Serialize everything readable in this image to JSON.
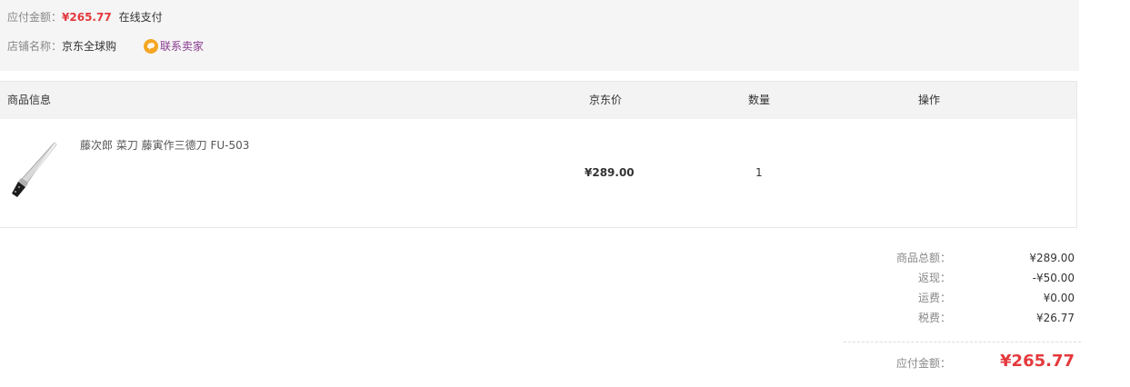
{
  "order_info": {
    "amount_label": "应付金额：",
    "amount_value": "¥265.77",
    "pay_method": "在线支付",
    "shop_label": "店铺名称：",
    "shop_name": "京东全球购",
    "contact_label": "联系卖家"
  },
  "table": {
    "headers": {
      "info": "商品信息",
      "price": "京东价",
      "qty": "数量",
      "op": "操作"
    },
    "item": {
      "name": "藤次郎 菜刀 藤寅作三德刀 FU-503",
      "price": "¥289.00",
      "qty": "1",
      "image_icon": "kitchen-knife-image"
    }
  },
  "summary": {
    "goods_total_label": "商品总额：",
    "goods_total_value": "¥289.00",
    "rebate_label": "返现：",
    "rebate_value": "-¥50.00",
    "shipping_label": "运费：",
    "shipping_value": "¥0.00",
    "tax_label": "税费：",
    "tax_value": "¥26.77",
    "payable_label": "应付金额：",
    "payable_value": "¥265.77"
  },
  "colors": {
    "accent_red": "#e4393c",
    "contact_purple": "#8a3b8f",
    "contact_icon": "#f5a623"
  }
}
